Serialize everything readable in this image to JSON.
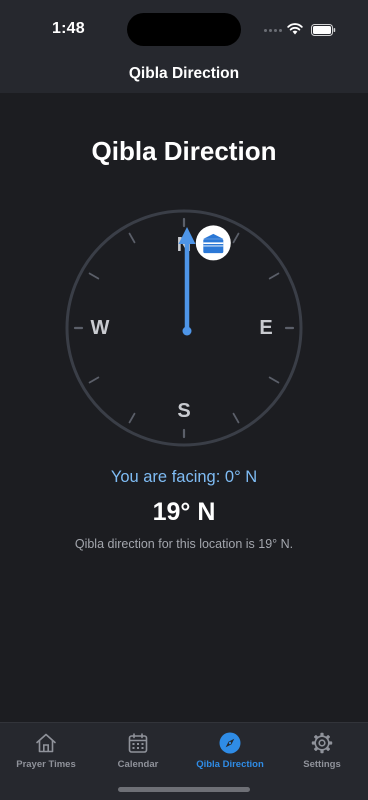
{
  "status_bar": {
    "time": "1:48"
  },
  "header": {
    "title": "Qibla Direction"
  },
  "main": {
    "title": "Qibla Direction",
    "compass": {
      "north": "N",
      "east": "E",
      "south": "S",
      "west": "W",
      "qibla_bearing_deg": 19
    },
    "facing_text": "You are facing: 0° N",
    "qibla_value": "19° N",
    "qibla_note": "Qibla direction for this location is 19° N."
  },
  "tabs": [
    {
      "label": "Prayer Times",
      "icon": "house-icon",
      "active": false
    },
    {
      "label": "Calendar",
      "icon": "calendar-icon",
      "active": false
    },
    {
      "label": "Qibla Direction",
      "icon": "compass-icon",
      "active": true
    },
    {
      "label": "Settings",
      "icon": "gear-icon",
      "active": false
    }
  ],
  "colors": {
    "background": "#1c1d21",
    "header": "#26282e",
    "accent": "#2f8ce6",
    "needle": "#4e95e8",
    "facing_text": "#7fbcf4"
  }
}
